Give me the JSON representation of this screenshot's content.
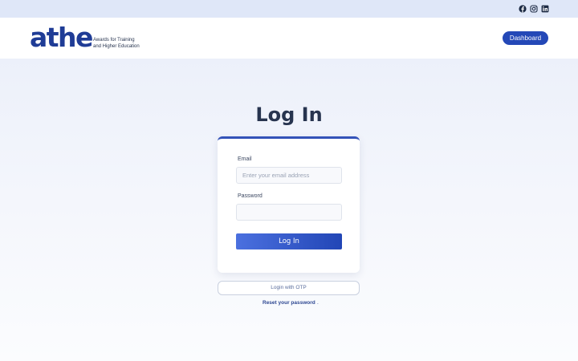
{
  "topbar": {
    "social_icons": [
      "facebook-icon",
      "instagram-icon",
      "linkedin-icon"
    ]
  },
  "header": {
    "logo_text": "athe",
    "tagline_line1": "Awards for Training",
    "tagline_line2": "and Higher Education",
    "dashboard_label": "Dashboard"
  },
  "main": {
    "title": "Log In",
    "email_label": "Email",
    "email_placeholder": "Enter your email address",
    "email_value": "",
    "password_label": "Password",
    "password_value": "",
    "login_button_label": "Log In",
    "otp_button_label": "Login with OTP",
    "reset_link_label": "Reset your password",
    "reset_suffix": "."
  },
  "colors": {
    "brand_blue": "#2448b7",
    "topbar_bg": "#dfe7f8",
    "text_dark": "#27344f"
  }
}
